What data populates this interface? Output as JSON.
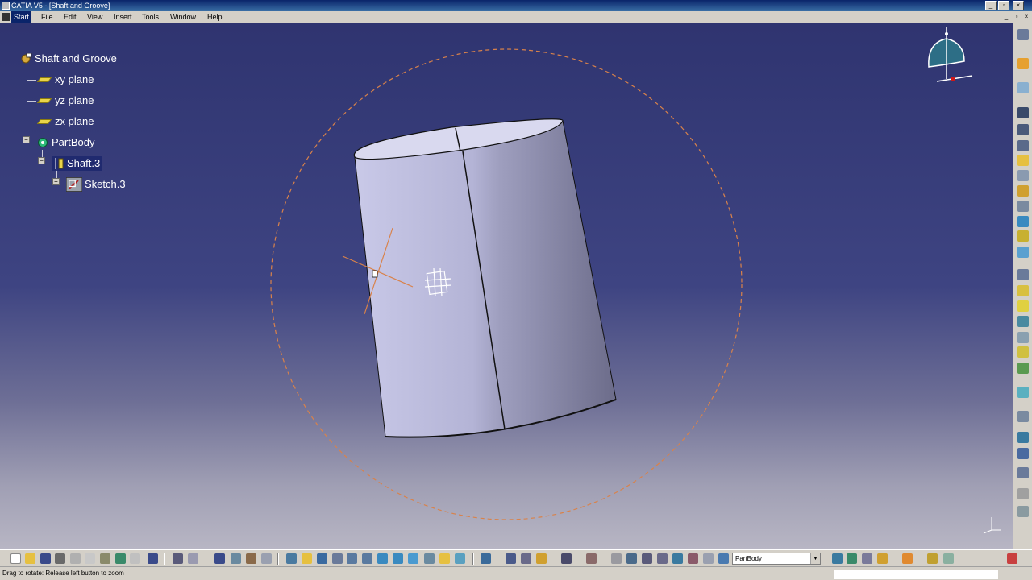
{
  "window": {
    "title": "CATIA V5 - [Shaft and Groove]",
    "controls": [
      "_",
      "▫",
      "×"
    ],
    "mdi_controls": [
      "_",
      "▫",
      "×"
    ]
  },
  "menu": {
    "items": [
      "Start",
      "File",
      "Edit",
      "View",
      "Insert",
      "Tools",
      "Window",
      "Help"
    ],
    "active": "Start"
  },
  "tree": {
    "root": "Shaft and Groove",
    "planes": [
      "xy plane",
      "yz plane",
      "zx plane"
    ],
    "body": "PartBody",
    "shaft": "Shaft.3",
    "sketch": "Sketch.3",
    "expander_collapse": "−",
    "expander_expand": "+"
  },
  "toolbar": {
    "current_body": "PartBody",
    "dropdown_glyph": "▼"
  },
  "status": {
    "message": "Drag to rotate: Release left button to zoom",
    "command_value": ""
  },
  "colors": {
    "viewport_top": "#2f3470",
    "viewport_bottom": "#b8b6c4",
    "rotation_circle": "#d9824a",
    "cylinder_light": "#c7c7e6",
    "cylinder_dark": "#6c6c8a"
  }
}
